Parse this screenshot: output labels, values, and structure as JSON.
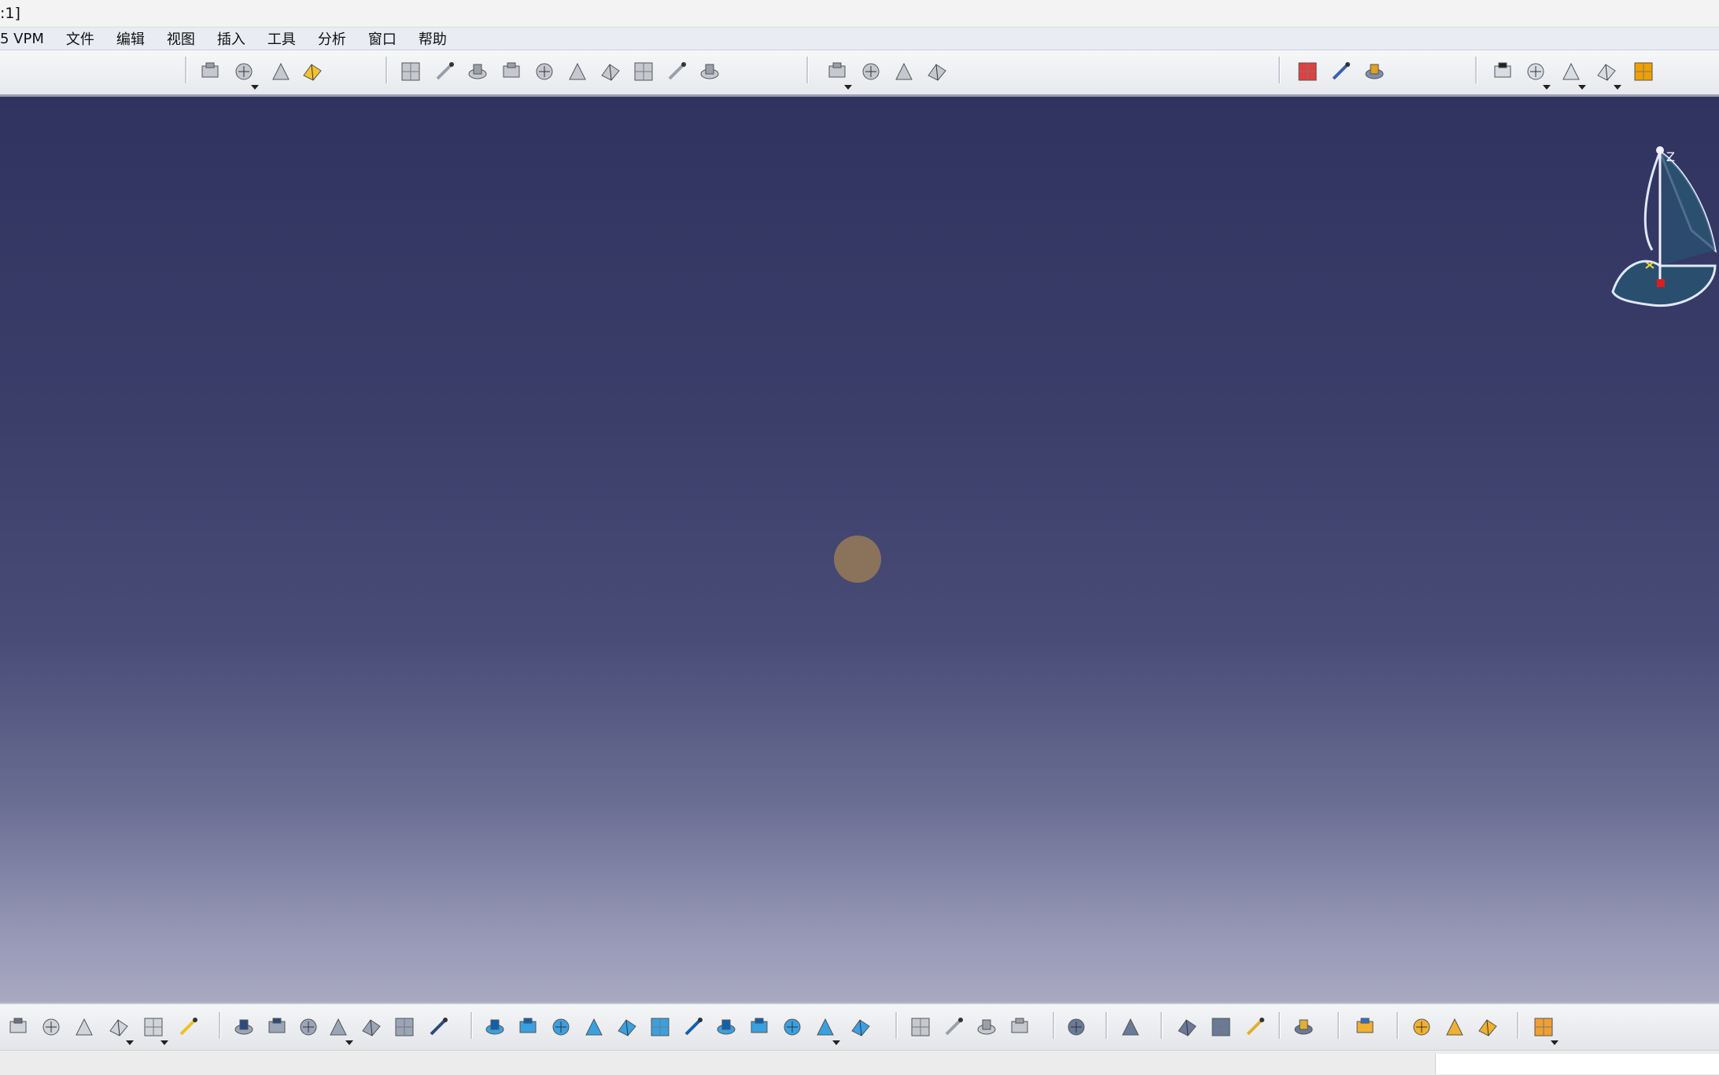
{
  "window": {
    "title_fragment": ":1]"
  },
  "menu": [
    {
      "label": "5 VPM"
    },
    {
      "label": "文件"
    },
    {
      "label": "编辑"
    },
    {
      "label": "视图"
    },
    {
      "label": "插入"
    },
    {
      "label": "工具"
    },
    {
      "label": "分析"
    },
    {
      "label": "窗口"
    },
    {
      "label": "帮助"
    }
  ],
  "toolbar_top_icons": [
    "catalog-icon",
    "tools-icon",
    "snapshot-icon",
    "light-icon",
    "sketch-icon",
    "block-icon",
    "rotate-block-icon",
    "slot-icon",
    "rib-icon",
    "stiffener-icon",
    "pocket-icon",
    "multi-pad-icon",
    "hole-icon",
    "thread-icon",
    "fillet-icon",
    "draft-icon",
    "shell-icon",
    "thickness-icon",
    "assembly-icon",
    "constraint-icon",
    "publication-icon",
    "axis-icon",
    "text-abc-icon",
    "leader-icon",
    "flag-icon",
    "annotation-icon"
  ],
  "toolbar_bottom_icons": [
    "cut-icon",
    "copy-icon",
    "paste-icon",
    "undo-icon",
    "redo-icon",
    "whats-this-icon",
    "formula-icon",
    "comment-icon",
    "parameter-icon",
    "table-icon",
    "tree-icon",
    "catalog-bottom-icon",
    "measure-list-icon",
    "fly-icon",
    "fit-all-icon",
    "pan-icon",
    "rotate-icon",
    "zoom-in-icon",
    "zoom-out-icon",
    "normal-view-icon",
    "multi-view-icon",
    "iso-view-icon",
    "shading-icon",
    "hide-show-icon",
    "swap-space-icon",
    "link-icon",
    "next-icon",
    "compare-icon",
    "compare2-icon",
    "camera-icon",
    "print-icon",
    "measure-between-icon",
    "measure-item-icon",
    "inertia-icon",
    "update-icon",
    "scan-icon",
    "render-icon",
    "material-icon",
    "color-icon",
    "grid-icon"
  ],
  "compass": {
    "axis_label": "Z"
  },
  "colors": {
    "viewport_top": "#30335f",
    "viewport_bottom": "#a9a9c2",
    "compass_fill": "#2a4f6e",
    "cursor_highlight": "#8f7558"
  }
}
